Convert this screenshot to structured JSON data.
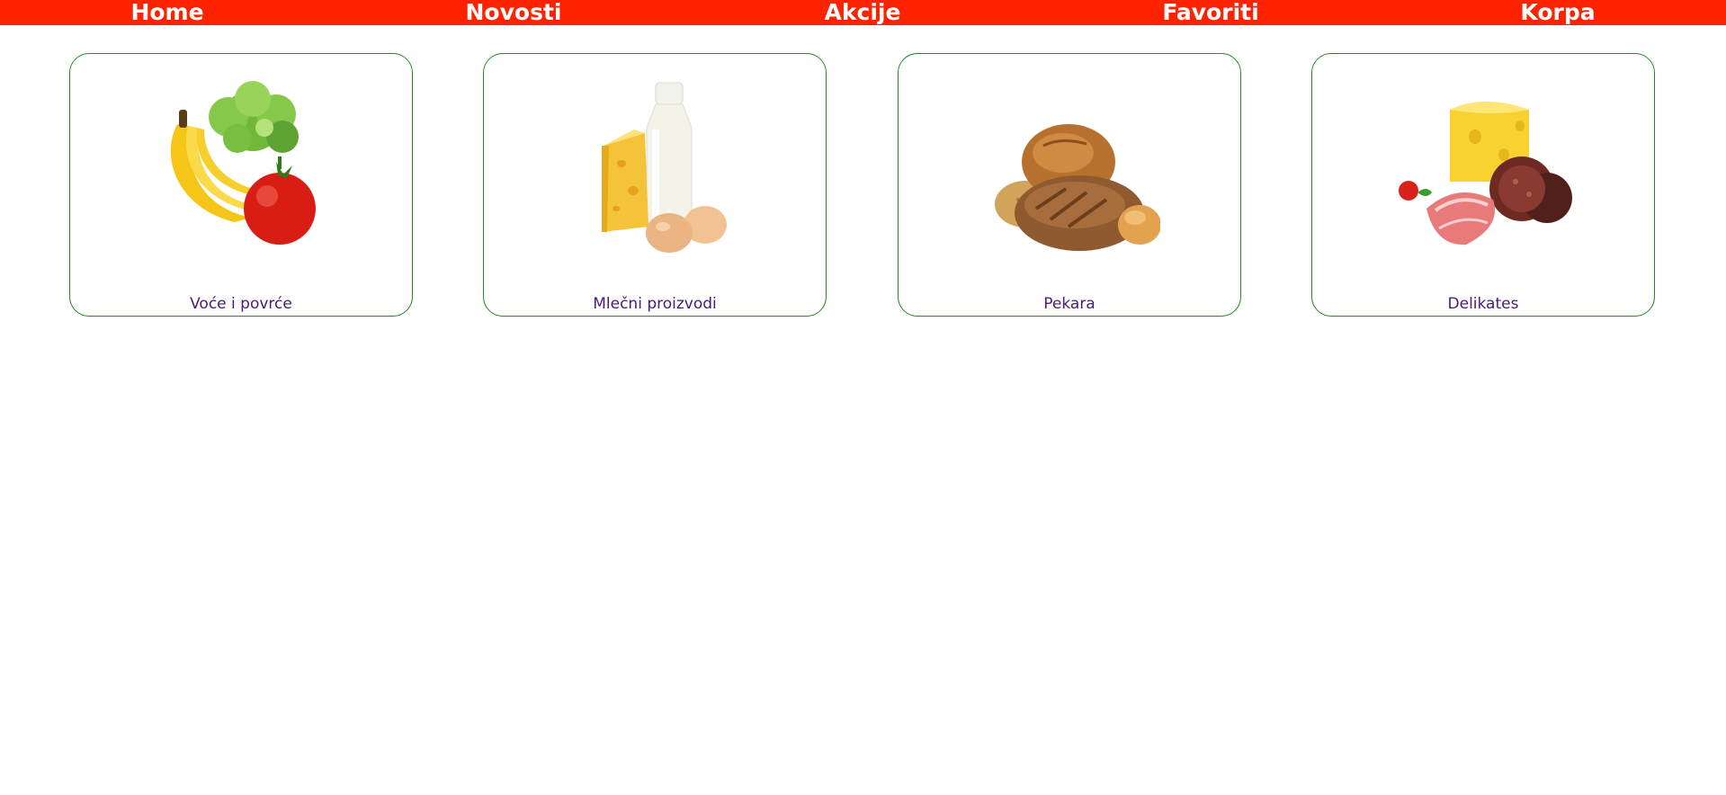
{
  "nav": {
    "items": [
      {
        "label": "Home"
      },
      {
        "label": "Novosti"
      },
      {
        "label": "Akcije"
      },
      {
        "label": "Favoriti"
      },
      {
        "label": "Korpa"
      }
    ]
  },
  "categories": [
    {
      "label": "Voće i povrće",
      "icon": "fruit-vegetables-image"
    },
    {
      "label": "Mlečni proizvodi",
      "icon": "dairy-image"
    },
    {
      "label": "Pekara",
      "icon": "bakery-image"
    },
    {
      "label": "Delikates",
      "icon": "deli-image"
    }
  ],
  "colors": {
    "nav_background": "#ff2200",
    "nav_text": "#ffffff",
    "card_border": "#1f8a1f",
    "card_label": "#4b1a78"
  }
}
